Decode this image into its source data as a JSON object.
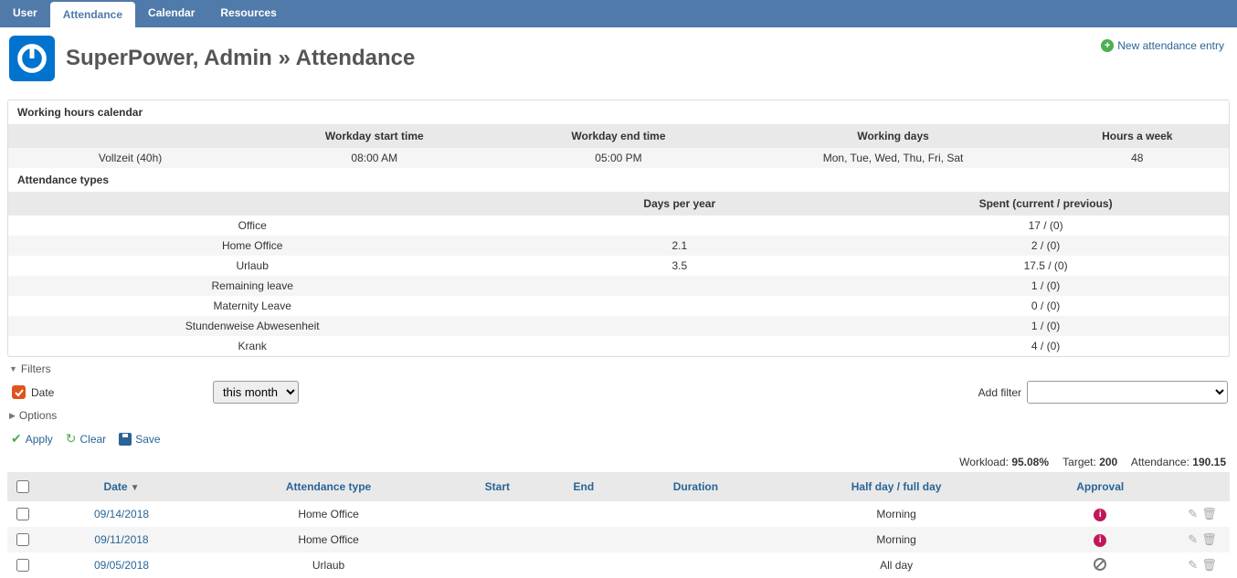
{
  "tabs": [
    "User",
    "Attendance",
    "Calendar",
    "Resources"
  ],
  "activeTab": 1,
  "title": "SuperPower, Admin » Attendance",
  "newEntryLabel": "New attendance entry",
  "workingHours": {
    "heading": "Working hours calendar",
    "columns": [
      "",
      "Workday start time",
      "Workday end time",
      "Working days",
      "Hours a week"
    ],
    "row": [
      "Vollzeit (40h)",
      "08:00 AM",
      "05:00 PM",
      "Mon, Tue, Wed, Thu, Fri, Sat",
      "48"
    ]
  },
  "attendanceTypes": {
    "heading": "Attendance types",
    "columns": [
      "",
      "Days per year",
      "Spent (current / previous)"
    ],
    "rows": [
      [
        "Office",
        "",
        "17 / (0)"
      ],
      [
        "Home Office",
        "2.1",
        "2 / (0)"
      ],
      [
        "Urlaub",
        "3.5",
        "17.5 / (0)"
      ],
      [
        "Remaining leave",
        "",
        "1 / (0)"
      ],
      [
        "Maternity Leave",
        "",
        "0 / (0)"
      ],
      [
        "Stundenweise Abwesenheit",
        "",
        "1 / (0)"
      ],
      [
        "Krank",
        "",
        "4 / (0)"
      ]
    ]
  },
  "filtersLabel": "Filters",
  "dateLabel": "Date",
  "dateSelected": "this month",
  "addFilterLabel": "Add filter",
  "optionsLabel": "Options",
  "actions": {
    "apply": "Apply",
    "clear": "Clear",
    "save": "Save"
  },
  "stats": {
    "workloadLabel": "Workload:",
    "workloadValue": "95.08%",
    "targetLabel": "Target:",
    "targetValue": "200",
    "attendanceLabel": "Attendance:",
    "attendanceValue": "190.15"
  },
  "tableHeaders": [
    "Date",
    "Attendance type",
    "Start",
    "End",
    "Duration",
    "Half day / full day",
    "Approval"
  ],
  "entries": [
    {
      "date": "09/14/2018",
      "type": "Home Office",
      "start": "",
      "end": "",
      "duration": "",
      "half": "Morning",
      "approval": "info"
    },
    {
      "date": "09/11/2018",
      "type": "Home Office",
      "start": "",
      "end": "",
      "duration": "",
      "half": "Morning",
      "approval": "info"
    },
    {
      "date": "09/05/2018",
      "type": "Urlaub",
      "start": "",
      "end": "",
      "duration": "",
      "half": "All day",
      "approval": "deny"
    }
  ]
}
